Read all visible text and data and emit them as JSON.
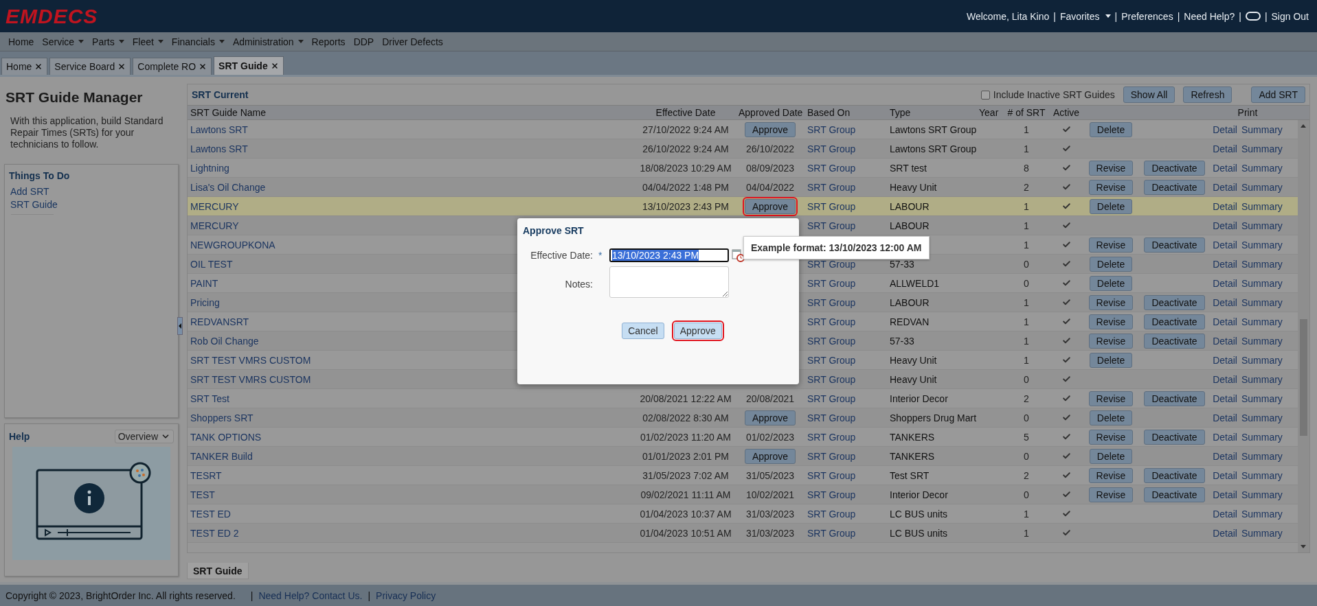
{
  "header": {
    "logo": "EMDECS",
    "separator": "|",
    "items": [
      {
        "kind": "text",
        "text": "Welcome, Lita Kino"
      },
      {
        "kind": "dropdown",
        "text": "Favorites"
      },
      {
        "kind": "link",
        "text": "Preferences"
      },
      {
        "kind": "link",
        "text": "Need Help?"
      },
      {
        "kind": "toggle"
      },
      {
        "kind": "link",
        "text": "Sign Out"
      }
    ]
  },
  "menu": [
    {
      "label": "Home",
      "has_menu": false
    },
    {
      "label": "Service",
      "has_menu": true
    },
    {
      "label": "Parts",
      "has_menu": true
    },
    {
      "label": "Fleet",
      "has_menu": true
    },
    {
      "label": "Financials",
      "has_menu": true
    },
    {
      "label": "Administration",
      "has_menu": true
    },
    {
      "label": "Reports",
      "has_menu": false
    },
    {
      "label": "DDP",
      "has_menu": false
    },
    {
      "label": "Driver Defects",
      "has_menu": false
    }
  ],
  "tabs": [
    {
      "label": "Home",
      "selected": false
    },
    {
      "label": "Service Board",
      "selected": false
    },
    {
      "label": "Complete RO",
      "selected": false
    },
    {
      "label": "SRT Guide",
      "selected": true
    }
  ],
  "sidebar": {
    "title": "SRT Guide Manager",
    "description": "With this application, build Standard Repair Times (SRTs) for your technicians to follow.",
    "things_to_do": {
      "title": "Things To Do",
      "links": [
        "Add SRT",
        "SRT Guide"
      ]
    },
    "help": {
      "title": "Help",
      "dropdown": "Overview"
    }
  },
  "table": {
    "title": "SRT Current",
    "include_inactive": {
      "label": "Include Inactive SRT Guides",
      "checked": false
    },
    "buttons": [
      "Show All",
      "Refresh",
      "Add SRT"
    ],
    "columns": {
      "name": "SRT Guide Name",
      "effective": "Effective Date",
      "approved": "Approved Date",
      "based_on": "Based On",
      "type": "Type",
      "year": "Year",
      "count": "# of SRT",
      "active": "Active",
      "print": "Print"
    },
    "rows": [
      {
        "name": "Lawtons SRT",
        "effective": "27/10/2022 9:24 AM",
        "approved": {
          "kind": "button",
          "label": "Approve",
          "outlined": false
        },
        "based_on": "SRT Group",
        "type": "Lawtons SRT Group",
        "count": "1",
        "active": true,
        "action_1": "Delete",
        "detail": "Detail",
        "summary": "Summary",
        "selected": false
      },
      {
        "name": "Lawtons SRT",
        "effective": "26/10/2022 9:24 AM",
        "approved": {
          "kind": "date",
          "text": "26/10/2022"
        },
        "based_on": "SRT Group",
        "type": "Lawtons SRT Group",
        "count": "1",
        "active": true,
        "detail": "Detail",
        "summary": "Summary",
        "selected": false
      },
      {
        "name": "Lightning",
        "effective": "18/08/2023 10:29 AM",
        "approved": {
          "kind": "date",
          "text": "08/09/2023"
        },
        "based_on": "SRT Group",
        "type": "SRT test",
        "count": "8",
        "active": true,
        "action_1": "Revise",
        "action_2": "Deactivate",
        "detail": "Detail",
        "summary": "Summary",
        "selected": false
      },
      {
        "name": "Lisa's Oil Change",
        "effective": "04/04/2022 1:48 PM",
        "approved": {
          "kind": "date",
          "text": "04/04/2022"
        },
        "based_on": "SRT Group",
        "type": "Heavy Unit",
        "count": "2",
        "active": true,
        "action_1": "Revise",
        "action_2": "Deactivate",
        "detail": "Detail",
        "summary": "Summary",
        "selected": false
      },
      {
        "name": "MERCURY",
        "effective": "13/10/2023 2:43 PM",
        "approved": {
          "kind": "button",
          "label": "Approve",
          "outlined": true
        },
        "based_on": "SRT Group",
        "type": "LABOUR",
        "count": "1",
        "active": true,
        "action_1": "Delete",
        "detail": "Detail",
        "summary": "Summary",
        "selected": true
      },
      {
        "name": "MERCURY",
        "based_on": "SRT Group",
        "type": "LABOUR",
        "count": "1",
        "active": true,
        "detail": "Detail",
        "summary": "Summary",
        "selected": false
      },
      {
        "name": "NEWGROUPKONA",
        "count": "1",
        "active": true,
        "action_1": "Revise",
        "action_2": "Deactivate",
        "detail": "Detail",
        "summary": "Summary",
        "selected": false
      },
      {
        "name": "OIL TEST",
        "based_on": "SRT Group",
        "type": "57-33",
        "count": "0",
        "active": true,
        "action_1": "Delete",
        "detail": "Detail",
        "summary": "Summary",
        "selected": false
      },
      {
        "name": "PAINT",
        "based_on": "SRT Group",
        "type": "ALLWELD1",
        "count": "0",
        "active": true,
        "action_1": "Delete",
        "detail": "Detail",
        "summary": "Summary",
        "selected": false
      },
      {
        "name": "Pricing",
        "based_on": "SRT Group",
        "type": "LABOUR",
        "count": "1",
        "active": true,
        "action_1": "Revise",
        "action_2": "Deactivate",
        "detail": "Detail",
        "summary": "Summary",
        "selected": false
      },
      {
        "name": "REDVANSRT",
        "based_on": "SRT Group",
        "type": "REDVAN",
        "count": "1",
        "active": true,
        "action_1": "Revise",
        "action_2": "Deactivate",
        "detail": "Detail",
        "summary": "Summary",
        "selected": false
      },
      {
        "name": "Rob Oil Change",
        "based_on": "SRT Group",
        "type": "57-33",
        "count": "1",
        "active": true,
        "action_1": "Revise",
        "action_2": "Deactivate",
        "detail": "Detail",
        "summary": "Summary",
        "selected": false
      },
      {
        "name": "SRT TEST VMRS CUSTOM",
        "based_on": "SRT Group",
        "type": "Heavy Unit",
        "count": "1",
        "active": true,
        "action_1": "Delete",
        "detail": "Detail",
        "summary": "Summary",
        "selected": false
      },
      {
        "name": "SRT TEST VMRS CUSTOM",
        "based_on": "SRT Group",
        "type": "Heavy Unit",
        "count": "0",
        "active": true,
        "detail": "Detail",
        "summary": "Summary",
        "selected": false
      },
      {
        "name": "SRT Test",
        "effective": "20/08/2021 12:22 AM",
        "approved": {
          "kind": "date",
          "text": "20/08/2021"
        },
        "based_on": "SRT Group",
        "type": "Interior Decor",
        "count": "2",
        "active": true,
        "action_1": "Revise",
        "action_2": "Deactivate",
        "detail": "Detail",
        "summary": "Summary",
        "selected": false
      },
      {
        "name": "Shoppers SRT",
        "effective": "02/08/2022 8:30 AM",
        "approved": {
          "kind": "button",
          "label": "Approve",
          "outlined": false
        },
        "based_on": "SRT Group",
        "type": "Shoppers Drug Mart",
        "count": "0",
        "active": true,
        "action_1": "Delete",
        "detail": "Detail",
        "summary": "Summary",
        "selected": false
      },
      {
        "name": "TANK OPTIONS",
        "effective": "01/02/2023 11:20 AM",
        "approved": {
          "kind": "date",
          "text": "01/02/2023"
        },
        "based_on": "SRT Group",
        "type": "TANKERS",
        "count": "5",
        "active": true,
        "action_1": "Revise",
        "action_2": "Deactivate",
        "detail": "Detail",
        "summary": "Summary",
        "selected": false
      },
      {
        "name": "TANKER Build",
        "effective": "01/01/2023 2:01 PM",
        "approved": {
          "kind": "button",
          "label": "Approve",
          "outlined": false
        },
        "based_on": "SRT Group",
        "type": "TANKERS",
        "count": "0",
        "active": true,
        "action_1": "Delete",
        "detail": "Detail",
        "summary": "Summary",
        "selected": false
      },
      {
        "name": "TESRT",
        "effective": "31/05/2023 7:02 AM",
        "approved": {
          "kind": "date",
          "text": "31/05/2023"
        },
        "based_on": "SRT Group",
        "type": "Test SRT",
        "count": "2",
        "active": true,
        "action_1": "Revise",
        "action_2": "Deactivate",
        "detail": "Detail",
        "summary": "Summary",
        "selected": false
      },
      {
        "name": "TEST",
        "effective": "09/02/2021 11:11 AM",
        "approved": {
          "kind": "date",
          "text": "10/02/2021"
        },
        "based_on": "SRT Group",
        "type": "Interior Decor",
        "count": "0",
        "active": true,
        "action_1": "Revise",
        "action_2": "Deactivate",
        "detail": "Detail",
        "summary": "Summary",
        "selected": false
      },
      {
        "name": "TEST ED",
        "effective": "01/04/2023 10:37 AM",
        "approved": {
          "kind": "date",
          "text": "31/03/2023"
        },
        "based_on": "SRT Group",
        "type": "LC BUS units",
        "count": "1",
        "active": true,
        "detail": "Detail",
        "summary": "Summary",
        "selected": false
      },
      {
        "name": "TEST ED 2",
        "effective": "01/04/2023 10:51 AM",
        "approved": {
          "kind": "date",
          "text": "31/03/2023"
        },
        "based_on": "SRT Group",
        "type": "LC BUS units",
        "count": "1",
        "active": true,
        "detail": "Detail",
        "summary": "Summary",
        "selected": false
      }
    ]
  },
  "bottom_tab": {
    "label": "SRT Guide",
    "selected": true
  },
  "dialog": {
    "title": "Approve SRT",
    "date_label": "Effective Date:",
    "required": "*",
    "date_value": "13/10/2023 2:43 PM",
    "value_selected": true,
    "notes_label": "Notes:",
    "buttons": [
      {
        "label": "Cancel",
        "outlined": false
      },
      {
        "label": "Approve",
        "outlined": true
      }
    ],
    "tooltip": "Example format: 13/10/2023 12:00 AM"
  },
  "footer": {
    "copyright": "Copyright © 2023, BrightOrder Inc. All rights reserved.",
    "separator": "|",
    "links": [
      "Need Help? Contact Us.",
      "Privacy Policy"
    ]
  }
}
